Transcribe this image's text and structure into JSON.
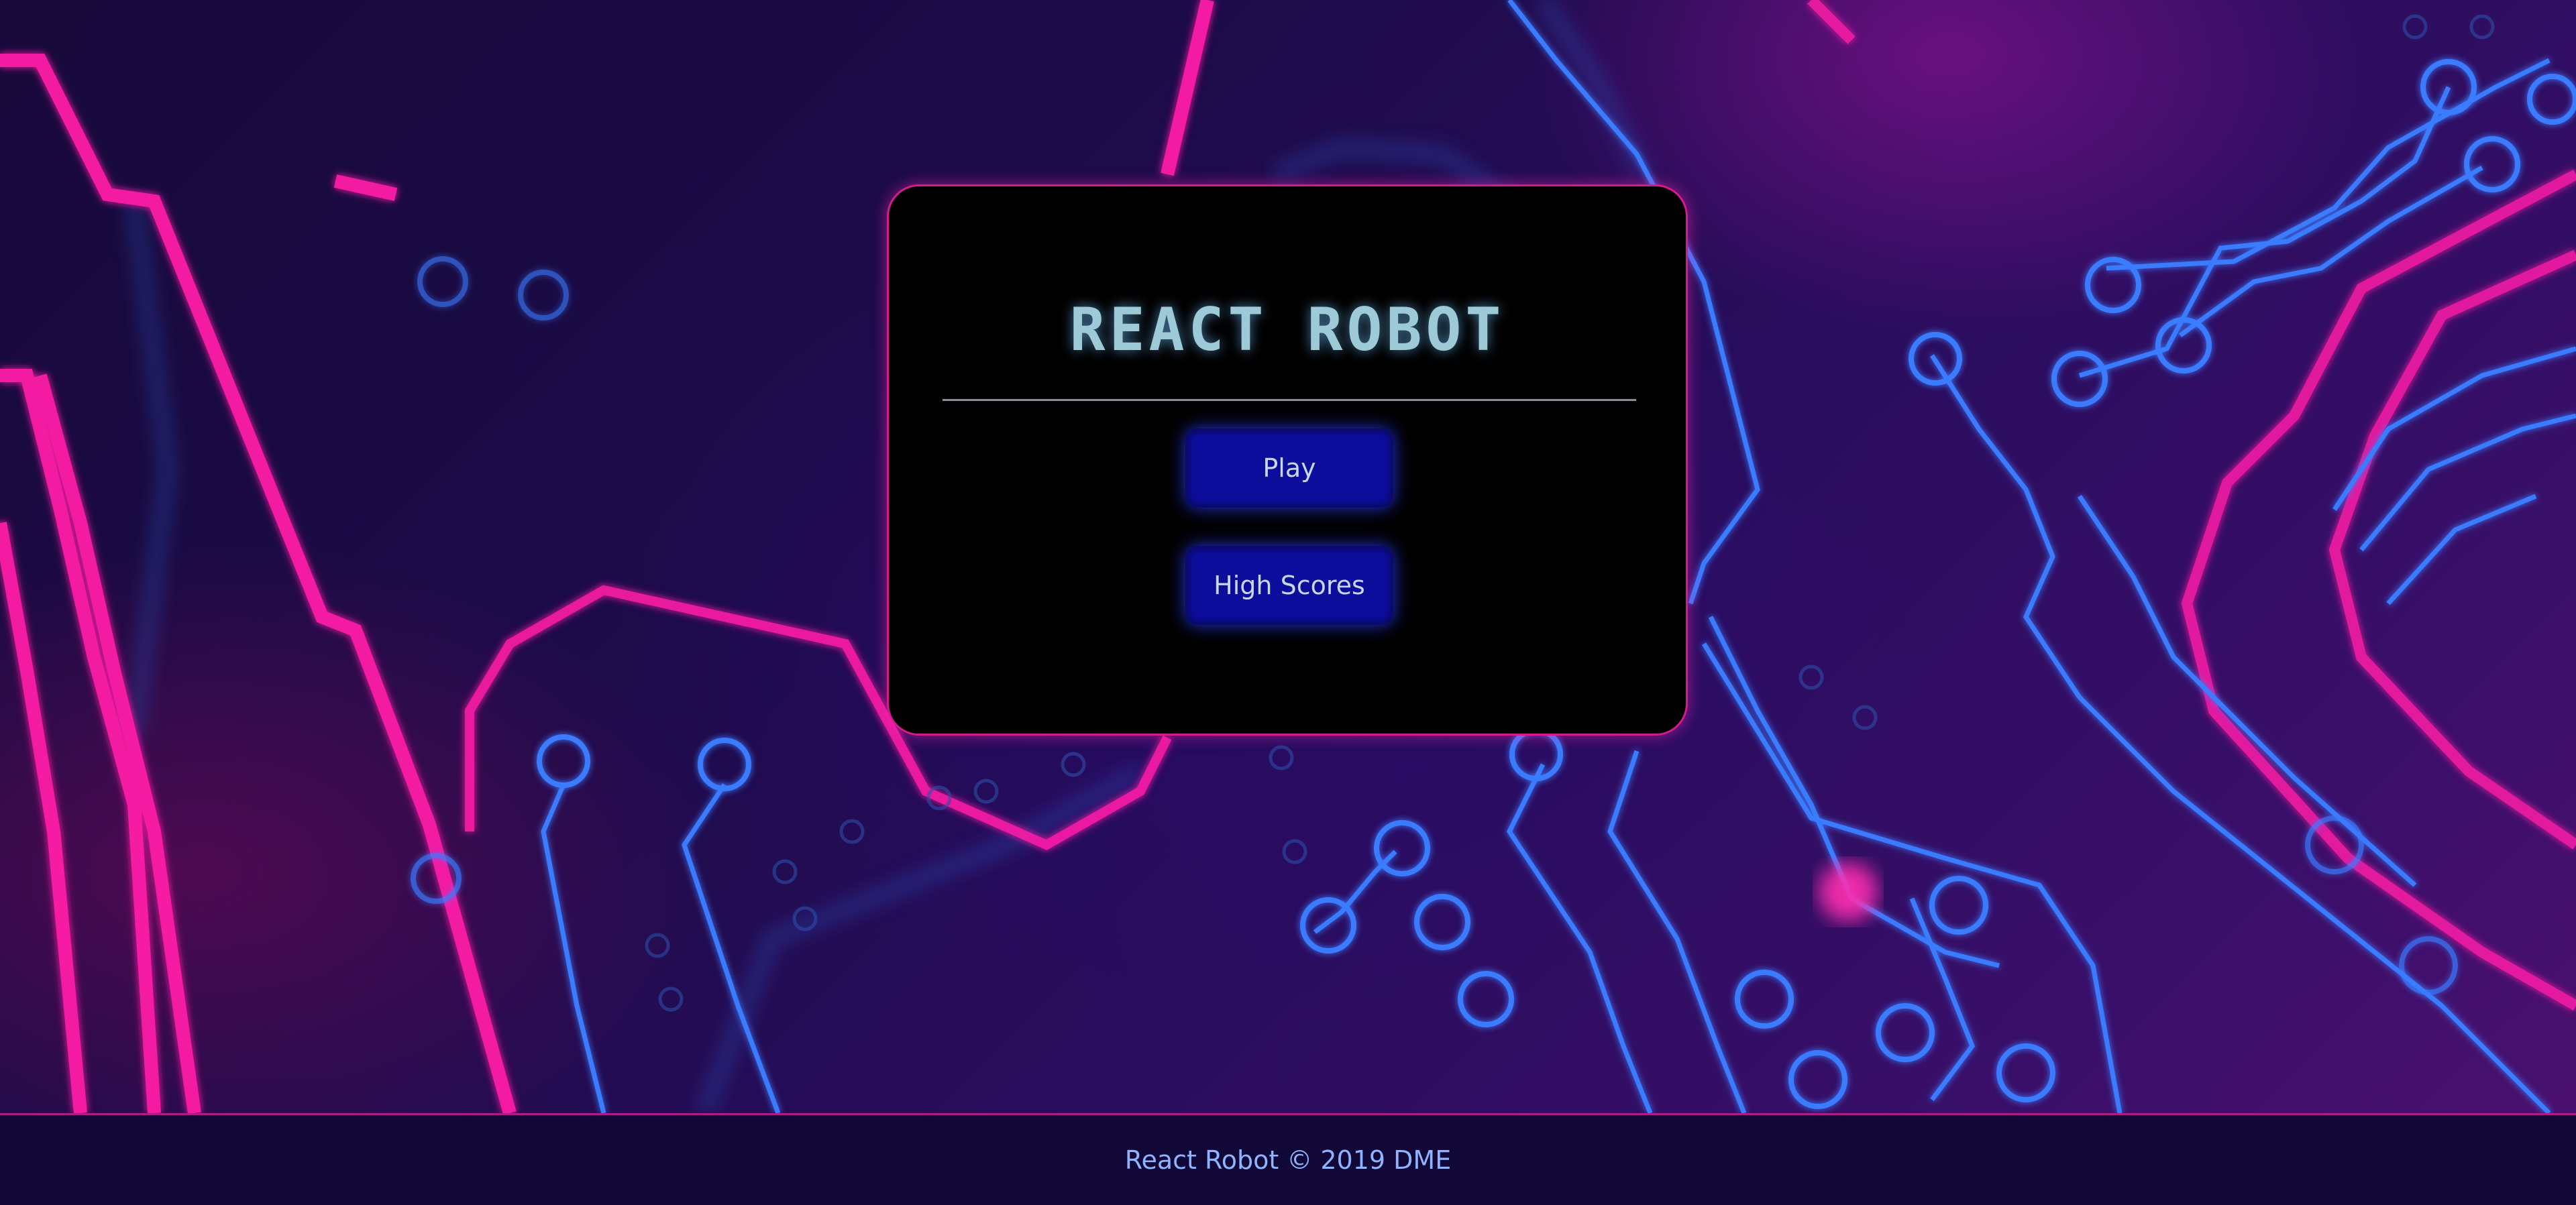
{
  "menu": {
    "title": "REACT ROBOT",
    "play_label": "Play",
    "high_scores_label": "High Scores"
  },
  "footer": {
    "text": "React Robot © 2019 DME"
  },
  "colors": {
    "card_border": "#d21c8c",
    "title": "#9ec9d6",
    "button_fill": "#0d0d9c",
    "button_text": "#c9d6ee",
    "footer_bg": "#120838",
    "footer_text": "#8fb4ff",
    "circuit_pink": "#ff1aa8",
    "circuit_blue": "#3a7bff"
  }
}
